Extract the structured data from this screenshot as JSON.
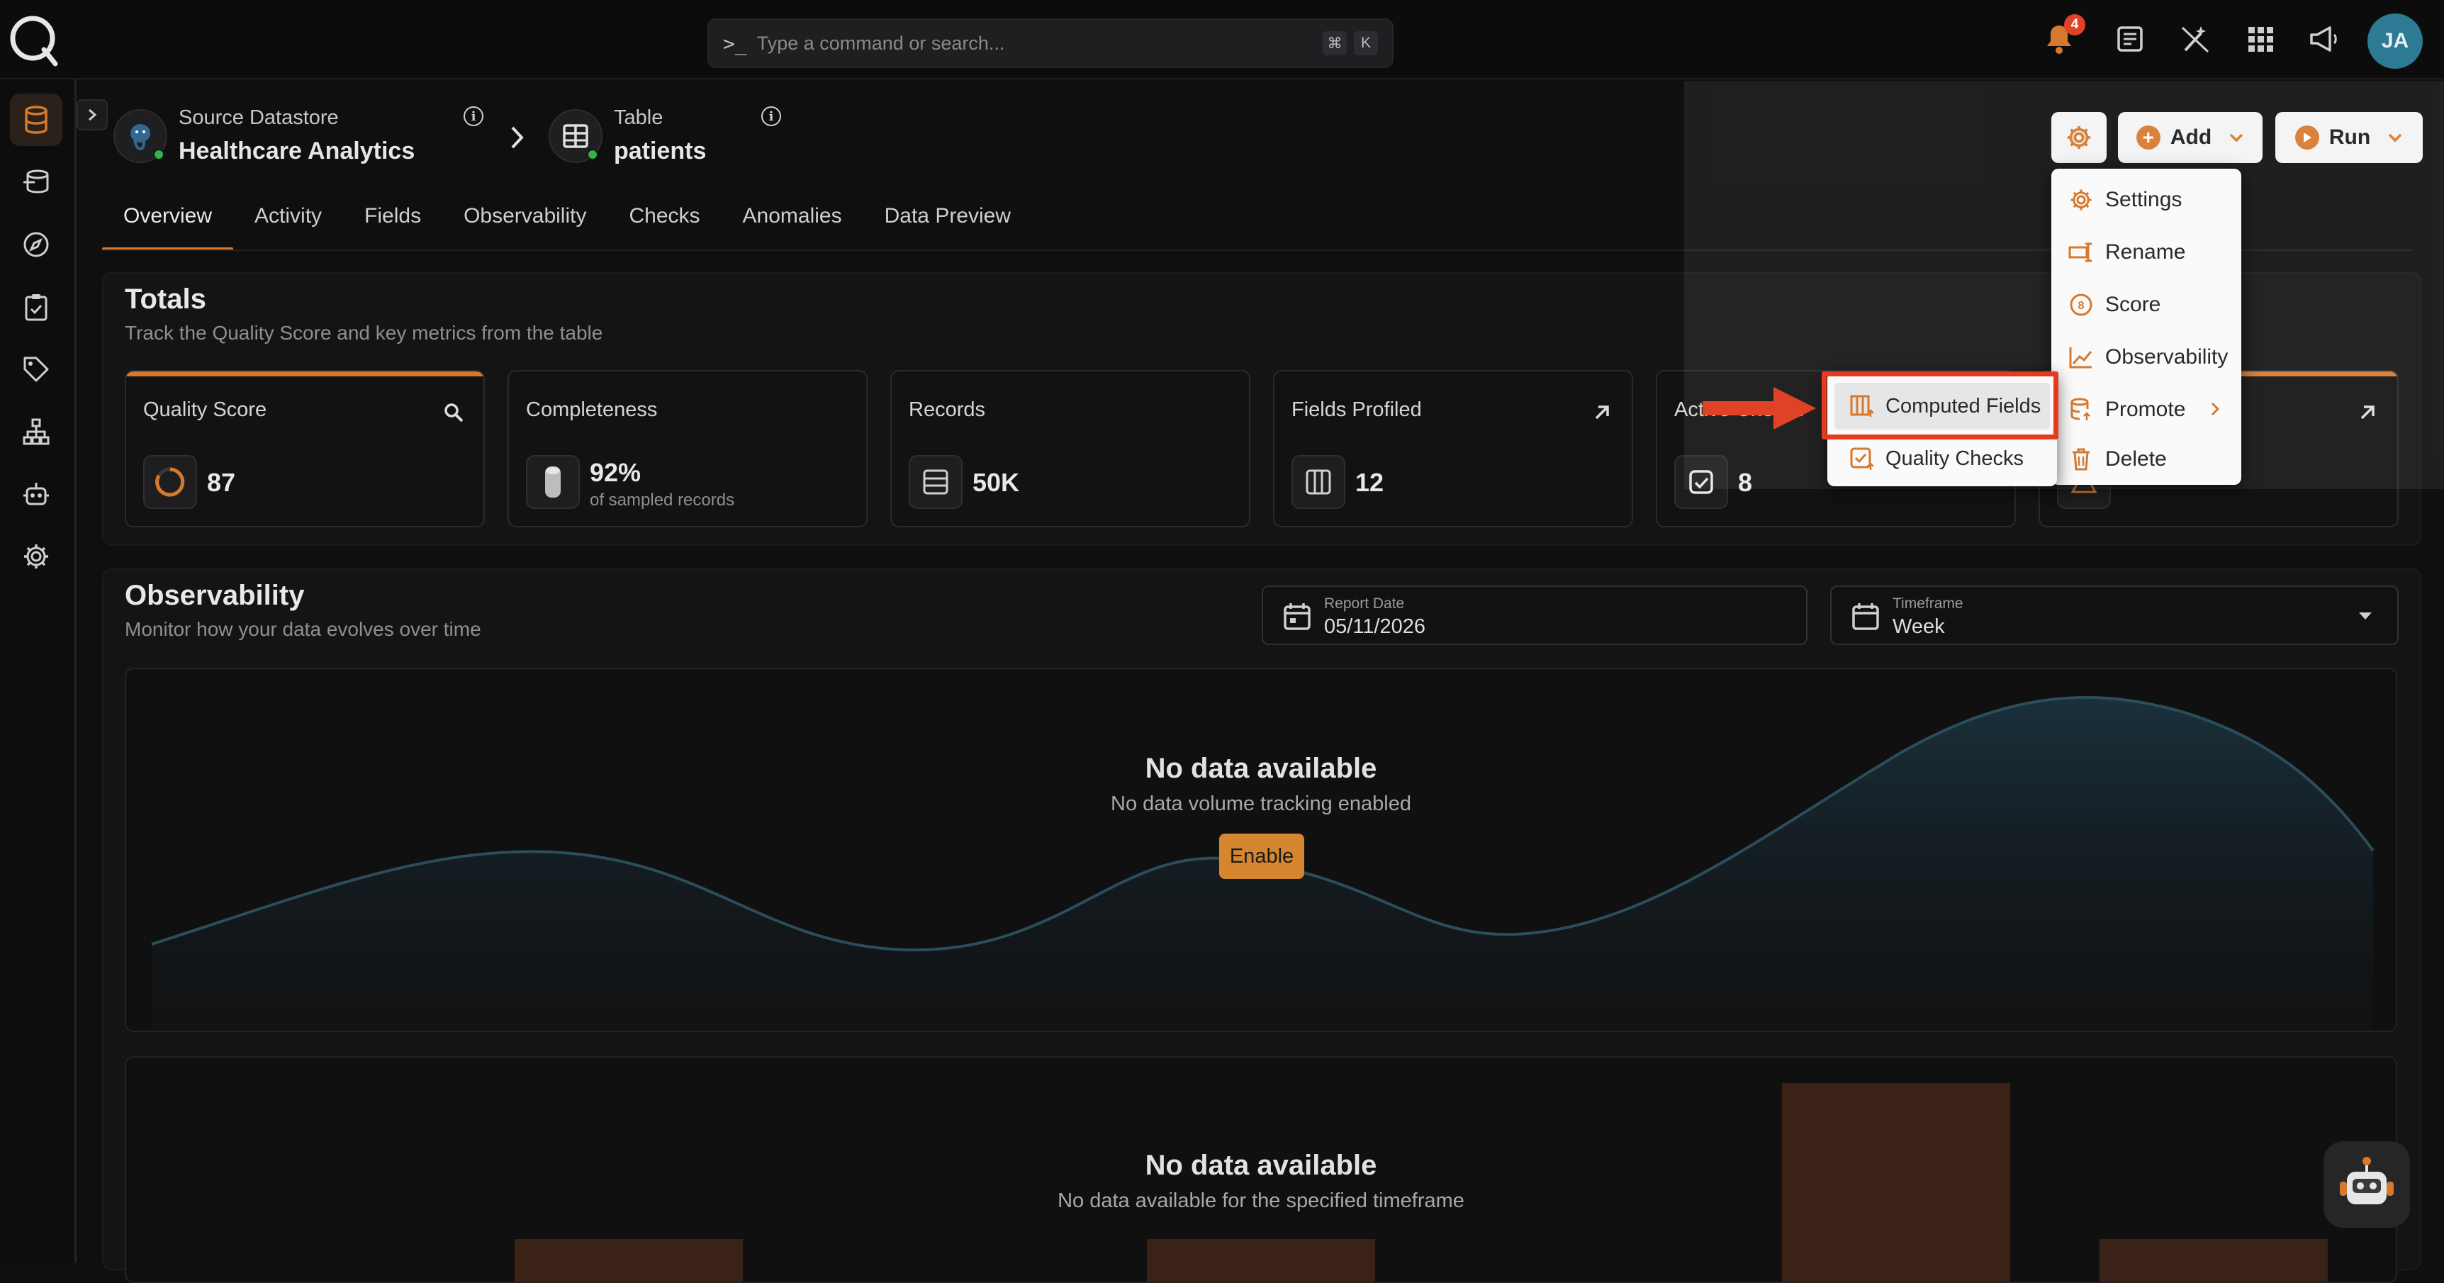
{
  "topbar": {
    "search_placeholder": "Type a command or search...",
    "search_prompt": ">_",
    "shortcut_keys": [
      "⌘",
      "K"
    ],
    "notification_count": "4",
    "avatar_initials": "JA"
  },
  "breadcrumb": {
    "datastore_label": "Source Datastore",
    "datastore_name": "Healthcare Analytics",
    "table_label": "Table",
    "table_name": "patients"
  },
  "actions": {
    "add_label": "Add",
    "run_label": "Run"
  },
  "tabs": [
    "Overview",
    "Activity",
    "Fields",
    "Observability",
    "Checks",
    "Anomalies",
    "Data Preview"
  ],
  "active_tab": "Overview",
  "totals": {
    "title": "Totals",
    "subtitle": "Track the Quality Score and key metrics from the table",
    "cards": [
      {
        "title": "Quality Score",
        "value": "87",
        "sub": "",
        "icon": "score-ring-icon"
      },
      {
        "title": "Completeness",
        "value": "92%",
        "sub": "of sampled records",
        "icon": "cylinder-icon"
      },
      {
        "title": "Records",
        "value": "50K",
        "sub": "",
        "icon": "records-icon"
      },
      {
        "title": "Fields Profiled",
        "value": "12",
        "sub": "",
        "icon": "columns-icon"
      },
      {
        "title": "Active Checks",
        "value": "8",
        "sub": "",
        "icon": "check-icon"
      },
      {
        "title": "",
        "value": "",
        "sub": "",
        "icon": "warning-icon"
      }
    ]
  },
  "observability": {
    "title": "Observability",
    "subtitle": "Monitor how your data evolves over time",
    "report_date_label": "Report Date",
    "report_date_value": "05/11/2026",
    "timeframe_label": "Timeframe",
    "timeframe_value": "Week",
    "chart1_title": "No data available",
    "chart1_sub": "No data volume tracking enabled",
    "enable_label": "Enable",
    "chart2_title": "No data available",
    "chart2_sub": "No data available for the specified timeframe"
  },
  "settings_menu": {
    "items": [
      "Settings",
      "Rename",
      "Score",
      "Observability",
      "Promote",
      "Delete"
    ]
  },
  "promote_submenu": {
    "items": [
      "Computed Fields",
      "Quality Checks"
    ],
    "highlighted": "Computed Fields"
  },
  "colors": {
    "accent": "#d5792e",
    "annotation_red": "#e04227",
    "avatar": "#2c7a93"
  }
}
